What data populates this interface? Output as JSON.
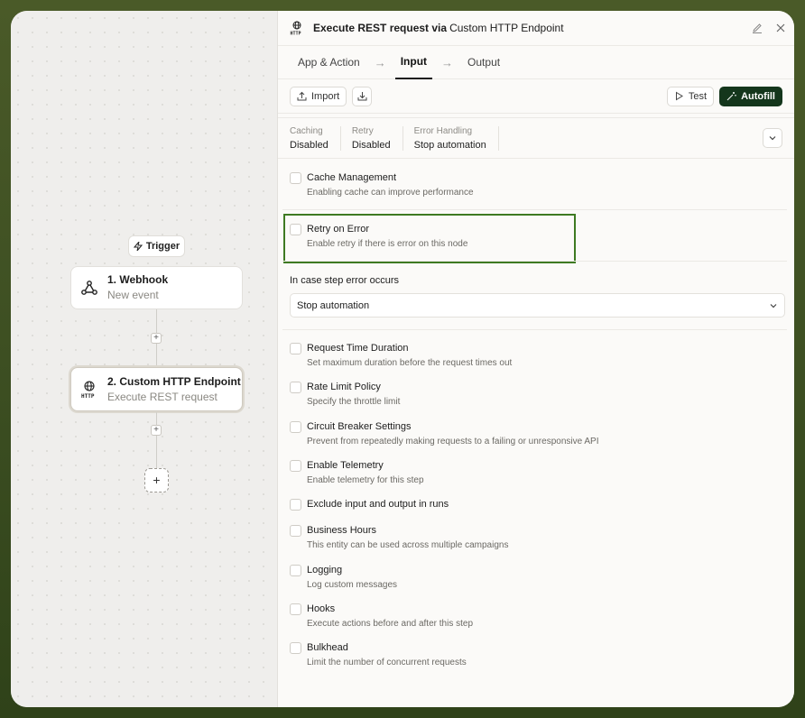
{
  "canvas": {
    "trigger_label": "Trigger",
    "nodes": [
      {
        "title": "1. Webhook",
        "subtitle": "New event"
      },
      {
        "title": "2. Custom HTTP Endpoint",
        "subtitle": "Execute REST request"
      }
    ],
    "add_label": "+"
  },
  "panel": {
    "title": "Execute REST request via",
    "subtitle": "Custom HTTP Endpoint",
    "tabs": [
      "App & Action",
      "Input",
      "Output"
    ],
    "active_tab": "Input",
    "toolbar": {
      "import_label": "Import",
      "test_label": "Test",
      "autofill_label": "Autofill"
    },
    "summary": [
      {
        "label": "Caching",
        "value": "Disabled"
      },
      {
        "label": "Retry",
        "value": "Disabled"
      },
      {
        "label": "Error Handling",
        "value": "Stop automation"
      }
    ],
    "options_top": [
      {
        "title": "Cache Management",
        "desc": "Enabling cache can improve performance"
      },
      {
        "title": "Retry on Error",
        "desc": "Enable retry if there is error on this node"
      }
    ],
    "error_section": {
      "label": "In case step error occurs",
      "selected": "Stop automation"
    },
    "options": [
      {
        "title": "Request Time Duration",
        "desc": "Set maximum duration before the request times out"
      },
      {
        "title": "Rate Limit Policy",
        "desc": "Specify the throttle limit"
      },
      {
        "title": "Circuit Breaker Settings",
        "desc": "Prevent from repeatedly making requests to a failing or unresponsive API"
      },
      {
        "title": "Enable Telemetry",
        "desc": "Enable telemetry for this step"
      },
      {
        "title": "Exclude input and output in runs",
        "desc": ""
      },
      {
        "title": "Business Hours",
        "desc": "This entity can be used across multiple campaigns"
      },
      {
        "title": "Logging",
        "desc": "Log custom messages"
      },
      {
        "title": "Hooks",
        "desc": "Execute actions before and after this step"
      },
      {
        "title": "Bulkhead",
        "desc": "Limit the number of concurrent requests"
      }
    ]
  },
  "colors": {
    "accent": "#14361c",
    "highlight": "#3e7a22",
    "background": "#3d4f22"
  }
}
